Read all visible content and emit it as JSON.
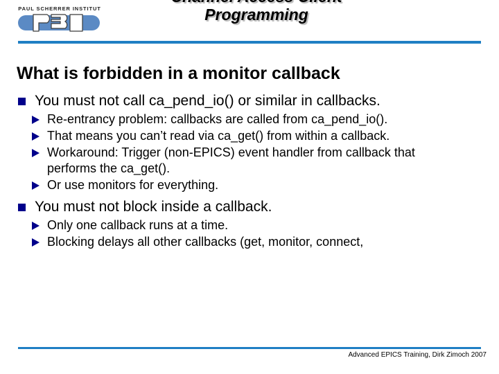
{
  "header": {
    "logo": {
      "institute_text": "PAUL SCHERRER INSTITUT",
      "acronym": "PSI"
    },
    "title": "Channel Access Client Programming",
    "accent_color": "#1f7fc4"
  },
  "content": {
    "heading": "What is forbidden in a monitor callback",
    "bullet_color_level1": "#00008b",
    "bullet_color_level2": "#00008b",
    "blocks": [
      {
        "level1": "You must not call ca_pend_io() or similar in callbacks.",
        "level2": [
          "Re-entrancy  problem: callbacks are called from ca_pend_io().",
          "That means you can’t read via ca_get() from within a callback.",
          "Workaround: Trigger (non-EPICS) event handler from callback that performs the ca_get().",
          "Or use monitors for everything."
        ]
      },
      {
        "level1": "You must not block inside a callback.",
        "level2": [
          "Only one callback runs at a time.",
          "Blocking delays all other callbacks (get, monitor, connect,"
        ]
      }
    ]
  },
  "footer": {
    "text": "Advanced EPICS Training, Dirk Zimoch 2007"
  }
}
